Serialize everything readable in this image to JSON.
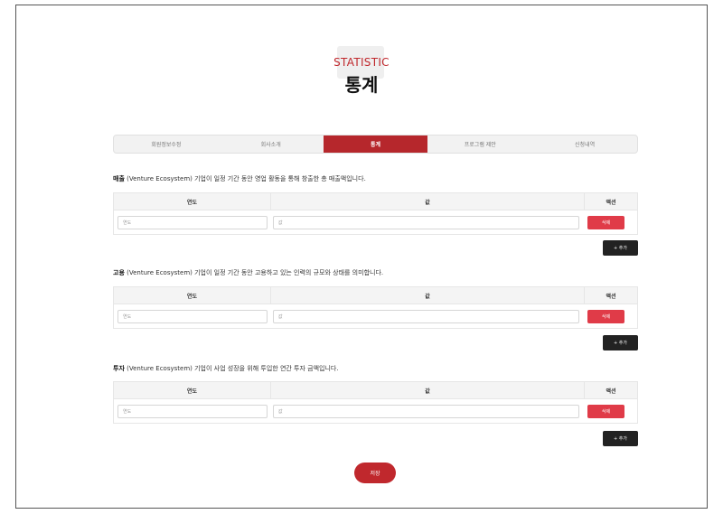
{
  "hero": {
    "subtitle": "STATISTIC",
    "title": "통계"
  },
  "tabs": [
    {
      "label": "회원정보수정",
      "active": false
    },
    {
      "label": "회사소개",
      "active": false
    },
    {
      "label": "통계",
      "active": true
    },
    {
      "label": "프로그램 제안",
      "active": false
    },
    {
      "label": "신청내역",
      "active": false
    }
  ],
  "sections": [
    {
      "name": "매출",
      "description": "(Venture Ecosystem)  기업이 일정 기간 동안 영업 활동을 통해 창출한 총 매출액입니다.",
      "columns": {
        "year": "연도",
        "value": "값",
        "action": "액션"
      },
      "row": {
        "year_placeholder": "연도",
        "value_placeholder": "값",
        "delete_label": "삭제"
      },
      "add_label": "+ 추가"
    },
    {
      "name": "고용",
      "description": "(Venture Ecosystem)  기업이 일정 기간 동안 고용하고 있는 인력의 규모와 상태를 의미합니다.",
      "columns": {
        "year": "연도",
        "value": "값",
        "action": "액션"
      },
      "row": {
        "year_placeholder": "연도",
        "value_placeholder": "값",
        "delete_label": "삭제"
      },
      "add_label": "+ 추가"
    },
    {
      "name": "투자",
      "description": "(Venture Ecosystem)  기업이 사업 성장을 위해 투입한 연간 투자 금액입니다.",
      "columns": {
        "year": "연도",
        "value": "값",
        "action": "액션"
      },
      "row": {
        "year_placeholder": "연도",
        "value_placeholder": "값",
        "delete_label": "삭제"
      },
      "add_label": "+ 추가"
    }
  ],
  "save_label": "저장",
  "colors": {
    "accent": "#c0282d",
    "tab_active": "#b6272c",
    "delete": "#e03b48",
    "add": "#222222"
  }
}
